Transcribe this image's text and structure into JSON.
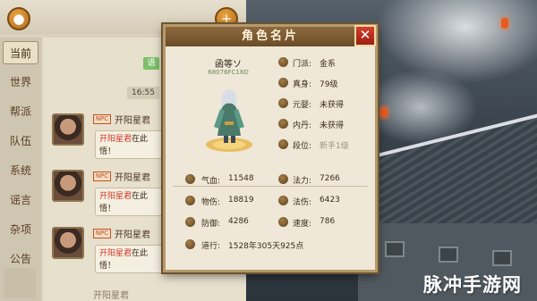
{
  "chat": {
    "tabs": [
      "当前",
      "世界",
      "帮派",
      "队伍",
      "系统",
      "谣言",
      "杂项",
      "公告"
    ],
    "green_tag": "语",
    "time": "16:55",
    "npc_badge": "NPC",
    "messages": [
      {
        "name": "开阳星君",
        "text_hl": "开阳星君",
        "text_rest": "在此",
        "text_line2": "悟！"
      },
      {
        "name": "开阳星君",
        "text_hl": "开阳星君",
        "text_rest": "在此",
        "text_line2": "悟！"
      },
      {
        "name": "开阳星君",
        "text_hl": "开阳星君",
        "text_rest": "在此",
        "text_line2": "悟！"
      }
    ],
    "partial_bottom": "开阳星君"
  },
  "card": {
    "title": "角色名片",
    "close_glyph": "✕",
    "char_name": "函等ソ",
    "char_id": "68076FC18D",
    "info": [
      {
        "icon": "faction-icon",
        "label": "门派:",
        "value": "金系",
        "dim": false
      },
      {
        "icon": "level-icon",
        "label": "真身:",
        "value": "79级",
        "dim": false
      },
      {
        "icon": "spirit-icon",
        "label": "元婴:",
        "value": "未获得",
        "dim": false
      },
      {
        "icon": "core-icon",
        "label": "内丹:",
        "value": "未获得",
        "dim": false
      },
      {
        "icon": "rank-icon",
        "label": "段位:",
        "value": "新手1级",
        "dim": true
      }
    ],
    "stats_left": [
      {
        "icon": "hp-icon",
        "label": "气血:",
        "value": "11548"
      },
      {
        "icon": "phys-attack-icon",
        "label": "物伤:",
        "value": "18819"
      },
      {
        "icon": "defense-icon",
        "label": "防御:",
        "value": "4286"
      },
      {
        "icon": "cultivation-icon",
        "label": "道行:",
        "value": "1528年305天925点"
      }
    ],
    "stats_right": [
      {
        "icon": "mana-icon",
        "label": "法力:",
        "value": "7266"
      },
      {
        "icon": "magic-attack-icon",
        "label": "法伤:",
        "value": "6423"
      },
      {
        "icon": "speed-icon",
        "label": "速度:",
        "value": "786"
      }
    ]
  },
  "watermark": "脉冲手游网"
}
